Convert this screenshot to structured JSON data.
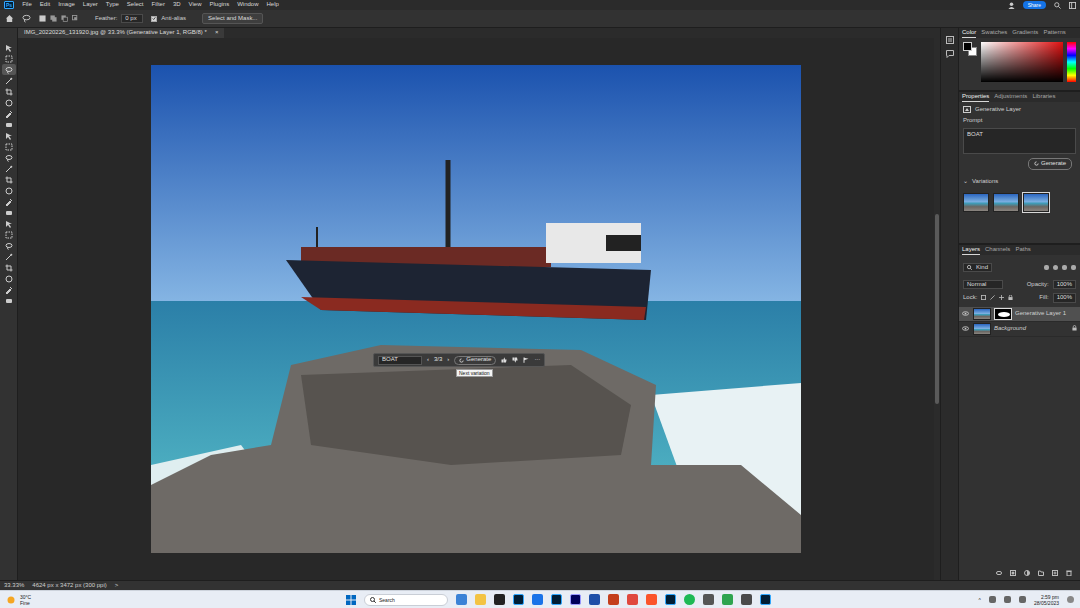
{
  "app": {
    "logo": "Ps"
  },
  "menu": [
    "File",
    "Edit",
    "Image",
    "Layer",
    "Type",
    "Select",
    "Filter",
    "3D",
    "View",
    "Plugins",
    "Window",
    "Help"
  ],
  "share": "Share",
  "options": {
    "feather_label": "Feather:",
    "feather_value": "0 px",
    "antialias": {
      "label": "Anti-alias",
      "checked": true
    },
    "select_mask": "Select and Mask..."
  },
  "tools": [
    {
      "selected": false
    },
    {
      "selected": false
    },
    {
      "selected": true
    },
    {
      "selected": false
    },
    {
      "selected": false
    },
    {
      "selected": false
    },
    {
      "selected": false
    },
    {
      "selected": false
    },
    {
      "selected": false
    },
    {
      "selected": false
    },
    {
      "selected": false
    },
    {
      "selected": false
    },
    {
      "selected": false
    },
    {
      "selected": false
    },
    {
      "selected": false
    },
    {
      "selected": false
    },
    {
      "selected": false
    },
    {
      "selected": false
    },
    {
      "selected": false
    },
    {
      "selected": false
    },
    {
      "selected": false
    },
    {
      "selected": false
    },
    {
      "selected": false
    },
    {
      "selected": false
    }
  ],
  "document_tab": {
    "title": "IMG_20220226_131920.jpg @ 33.3% (Generative Layer 1, RGB/8) *",
    "close": "×"
  },
  "contextual_bar": {
    "prompt": "BOAT",
    "prev": "‹",
    "counter": "3/3",
    "next": "›",
    "generate": "Generate",
    "more": "···"
  },
  "tooltip": "Next variation",
  "color_panel": {
    "tabs": [
      {
        "label": "Color",
        "selected": true
      },
      {
        "label": "Swatches",
        "selected": false
      },
      {
        "label": "Gradients",
        "selected": false
      },
      {
        "label": "Patterns",
        "selected": false
      }
    ]
  },
  "properties": {
    "tabs": [
      {
        "label": "Properties",
        "selected": true
      },
      {
        "label": "Adjustments",
        "selected": false
      },
      {
        "label": "Libraries",
        "selected": false
      }
    ],
    "layer_type": "Generative Layer",
    "prompt_label": "Prompt",
    "prompt": "BOAT",
    "generate": "Generate",
    "variations_label": "Variations",
    "variations": [
      {
        "selected": false
      },
      {
        "selected": false
      },
      {
        "selected": true
      }
    ]
  },
  "layers": {
    "tabs": [
      {
        "label": "Layers",
        "selected": true
      },
      {
        "label": "Channels",
        "selected": false
      },
      {
        "label": "Paths",
        "selected": false
      }
    ],
    "filter": "Kind",
    "blend": "Normal",
    "opacity_label": "Opacity:",
    "opacity": "100%",
    "lock_label": "Lock:",
    "fill_label": "Fill:",
    "fill": "100%",
    "items": [
      {
        "name": "Generative Layer 1",
        "selected": true,
        "visible": true,
        "locked": false,
        "kind": "generative"
      },
      {
        "name": "Background",
        "selected": false,
        "visible": true,
        "locked": true,
        "kind": "background"
      }
    ]
  },
  "status_bar": {
    "zoom": "33.33%",
    "size": "4624 px x 3472 px (300 ppi)",
    "arrow": ">"
  },
  "taskbar": {
    "weather": {
      "temp": "30°C",
      "text": "Fine"
    },
    "search": "Search",
    "time": "2:59 pm",
    "date": "28/05/2023"
  }
}
